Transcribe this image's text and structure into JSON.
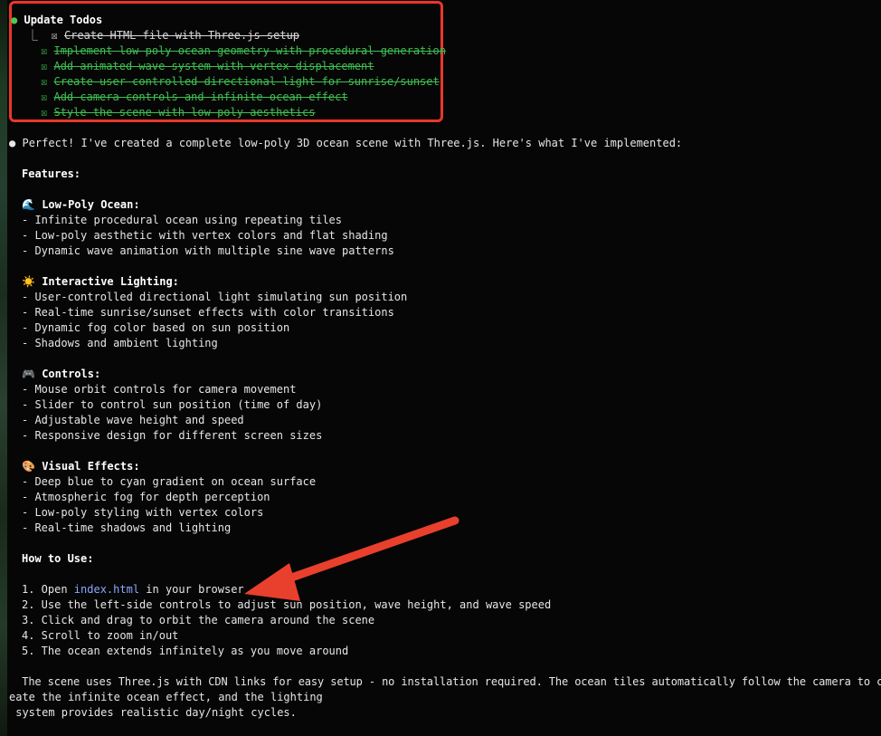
{
  "todos": {
    "title": "Update Todos",
    "tree_glyph": "⎿",
    "check_glyph": "☒",
    "items": [
      "Create HTML file with Three.js setup",
      "Implement low-poly ocean geometry with procedural generation",
      "Add animated wave system with vertex displacement",
      "Create user-controlled directional light for sunrise/sunset",
      "Add camera controls and infinite ocean effect",
      "Style the scene with low-poly aesthetics"
    ]
  },
  "message": {
    "bullet": "●",
    "intro": "Perfect! I've created a complete low-poly 3D ocean scene with Three.js. Here's what I've implemented:",
    "features_heading": "Features:",
    "sections": [
      {
        "icon_name": "wave-icon",
        "icon": "🌊",
        "heading": "Low-Poly Ocean:",
        "items": [
          "- Infinite procedural ocean using repeating tiles",
          "- Low-poly aesthetic with vertex colors and flat shading",
          "- Dynamic wave animation with multiple sine wave patterns"
        ]
      },
      {
        "icon_name": "sun-icon",
        "icon": "☀️",
        "heading": "Interactive Lighting:",
        "items": [
          "- User-controlled directional light simulating sun position",
          "- Real-time sunrise/sunset effects with color transitions",
          "- Dynamic fog color based on sun position",
          "- Shadows and ambient lighting"
        ]
      },
      {
        "icon_name": "gamepad-icon",
        "icon": "🎮",
        "heading": "Controls:",
        "items": [
          "- Mouse orbit controls for camera movement",
          "- Slider to control sun position (time of day)",
          "- Adjustable wave height and speed",
          "- Responsive design for different screen sizes"
        ]
      },
      {
        "icon_name": "palette-icon",
        "icon": "🎨",
        "heading": "Visual Effects:",
        "items": [
          "- Deep blue to cyan gradient on ocean surface",
          "- Atmospheric fog for depth perception",
          "- Low-poly styling with vertex colors",
          "- Real-time shadows and lighting"
        ]
      }
    ],
    "howto_heading": "How to Use:",
    "steps": {
      "s1_prefix": "1. Open ",
      "s1_link": "index.html",
      "s1_suffix": " in your browser",
      "s2": "2. Use the left-side controls to adjust sun position, wave height, and wave speed",
      "s3": "3. Click and drag to orbit the camera around the scene",
      "s4": "4. Scroll to zoom in/out",
      "s5": "5. The ocean extends infinitely as you move around"
    },
    "footer": [
      "  The scene uses Three.js with CDN links for easy setup - no installation required. The ocean tiles automatically follow the camera to cr",
      "eate the infinite ocean effect, and the lighting",
      " system provides realistic day/night cycles."
    ]
  },
  "colors": {
    "highlight_box": "#e8372a",
    "annotation_arrow": "#e8402c",
    "done_text": "#3fbf52",
    "link": "#8aa8ff"
  }
}
